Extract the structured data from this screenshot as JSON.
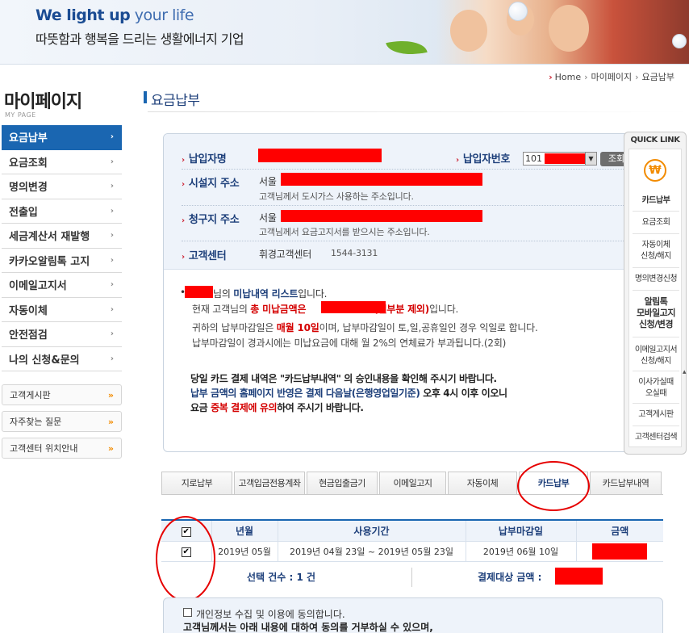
{
  "banner": {
    "slogan_en_bold": "We light up",
    "slogan_en_light": " your life",
    "slogan_ko": "따뜻함과 행복을 드리는 생활에너지 기업"
  },
  "breadcrumb": {
    "home": "Home",
    "level1": "마이페이지",
    "level2": "요금납부"
  },
  "sidebar": {
    "title": "마이페이지",
    "subtitle": "MY PAGE",
    "items": [
      {
        "label": "요금납부"
      },
      {
        "label": "요금조회"
      },
      {
        "label": "명의변경"
      },
      {
        "label": "전출입"
      },
      {
        "label": "세금계산서 재발행"
      },
      {
        "label": "카카오알림톡 고지"
      },
      {
        "label": "이메일고지서"
      },
      {
        "label": "자동이체"
      },
      {
        "label": "안전점검"
      },
      {
        "label": "나의 신청&문의"
      }
    ],
    "links": [
      {
        "label": "고객게시판"
      },
      {
        "label": "자주찾는 질문"
      },
      {
        "label": "고객센터 위치안내"
      }
    ],
    "link_glyph": "»",
    "chevron_glyph": "›"
  },
  "page": {
    "title": "요금납부"
  },
  "info": {
    "payer_name_label": "납입자명",
    "payer_no_label": "납입자번호",
    "payer_no_prefix": "101",
    "lookup_button": "조회",
    "facility_label": "시설지 주소",
    "facility_city": "서울",
    "facility_note": "고객님께서 도시가스 사용하는 주소입니다.",
    "billing_label": "청구지 주소",
    "billing_city": "서울",
    "billing_note": "고객님께서 요금고지서를 받으시는 주소입니다.",
    "center_label": "고객센터",
    "center_name": "휘경고객센터",
    "center_phone": "1544-3131"
  },
  "unpaid": {
    "line1_suffix": "님의 ",
    "line1_bold": "미납내역 리스트",
    "line1_end": "입니다.",
    "line2_start": "현재 고객님의 ",
    "line2_red1": "총 미납금액은 ",
    "line2_red2": "(일부분 제외)",
    "line2_end": "입니다.",
    "line3_start": "귀하의 납부마감일은 ",
    "line3_red": "매월 10일",
    "line3_end": "이며, 납부마감일이 토,일,공휴일인 경우 익일로 합니다.",
    "line4": "납부마감일이 경과시에는 미납요금에 대해 월 2%의 연체료가 부과됩니다.(2회)"
  },
  "notice": {
    "line1": "당일 카드 결제 내역은 \"카드납부내역\" 의 승인내용을 확인해 주시기 바랍니다.",
    "line2_blue": "납부 금액의 홈페이지 반영은 결제 다음날(은행영업일기준)",
    "line2_end": " 오후 4시 이후 이오니",
    "line3_start": "요금 ",
    "line3_red": "중복 결제에 유의",
    "line3_end": "하여 주시기 바랍니다."
  },
  "quick_link": {
    "title": "QUICK LINK",
    "icon_glyph": "₩",
    "items": [
      "카드납부",
      "요금조회",
      "자동이체\n신청/해지",
      "명의변경신청",
      "알림톡\n모바일고지\n신청/변경",
      "이메일고지서\n신청/해지",
      "이사가실때\n오실때",
      "고객게시판",
      "고객센터검색"
    ]
  },
  "tabs": [
    {
      "label": "지로납부"
    },
    {
      "label": "고객입금전용계좌"
    },
    {
      "label": "현금입출금기"
    },
    {
      "label": "이메일고지"
    },
    {
      "label": "자동이체"
    },
    {
      "label": "카드납부"
    },
    {
      "label": "카드납부내역"
    }
  ],
  "table": {
    "headers": [
      "",
      "년월",
      "사용기간",
      "납부마감일",
      "금액"
    ],
    "rows": [
      {
        "month": "2019년 05월",
        "period": "2019년 04월 23일 ~ 2019년 05월 23일",
        "due": "2019년 06월 10일"
      }
    ],
    "check_glyph": "✔"
  },
  "summary": {
    "count_text": "선택 건수 : 1 건",
    "amount_label": "결제대상 금액 :"
  },
  "consent": {
    "line1": "개인정보 수집 및 이용에 동의합니다.",
    "line2": "고객님께서는 아래 내용에 대하여 동의를 거부하실 수 있으며,"
  },
  "colors": {
    "accent": "#1a66b1",
    "heading": "#1d3f7a",
    "redact": "#ff0000",
    "annotation": "#e60000",
    "orange": "#f28b00"
  }
}
